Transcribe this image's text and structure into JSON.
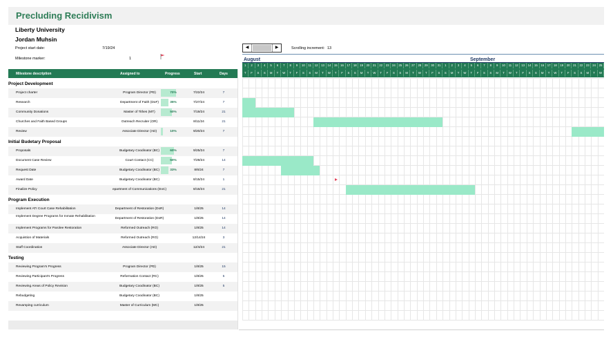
{
  "title": "Precluding Recidivism",
  "organization": "Liberty University",
  "author": "Jordan Muhsin",
  "meta": {
    "start_label": "Project start date:",
    "start_value": "7/19/24",
    "marker_label": "Milestone marker:",
    "marker_value": "1"
  },
  "scroll": {
    "left_label": "◀",
    "right_label": "▶",
    "increment_label": "Scrolling increment:",
    "increment_value": "13"
  },
  "months": [
    "August",
    "September"
  ],
  "day_numbers": [
    "1",
    "2",
    "3",
    "4",
    "5",
    "6",
    "7",
    "8",
    "9",
    "10",
    "11",
    "12",
    "13",
    "14",
    "15",
    "16",
    "17",
    "18",
    "19",
    "20",
    "21",
    "22",
    "23",
    "24",
    "25",
    "26",
    "27",
    "28",
    "29",
    "30",
    "31",
    "1",
    "2",
    "3",
    "4",
    "5",
    "6",
    "7",
    "8",
    "9",
    "10",
    "11",
    "12",
    "13",
    "14",
    "15",
    "16",
    "17",
    "18",
    "19",
    "20",
    "21",
    "22",
    "23",
    "24",
    "25"
  ],
  "day_letters": [
    "T",
    "F",
    "S",
    "S",
    "M",
    "T",
    "W",
    "T",
    "F",
    "S",
    "S",
    "M",
    "T",
    "W",
    "T",
    "F",
    "S",
    "S",
    "M",
    "T",
    "W",
    "T",
    "F",
    "S",
    "S",
    "M",
    "T",
    "W",
    "T",
    "F",
    "S",
    "S",
    "M",
    "T",
    "W",
    "T",
    "F",
    "S",
    "S",
    "M",
    "T",
    "W",
    "T",
    "F",
    "S",
    "S",
    "M",
    "T",
    "W",
    "T",
    "F",
    "S",
    "S",
    "M",
    "T",
    "W"
  ],
  "columns": {
    "desc": "Milestone description",
    "assigned": "Assigned to",
    "progress": "Progress",
    "start": "Start",
    "days": "Days"
  },
  "sections": [
    {
      "name": "Project Development",
      "rows": [
        {
          "desc": "Project charter",
          "assigned": "Program Director (PD)",
          "progress": "70%",
          "pct": 0.7,
          "start": "7/22/24",
          "days": "7",
          "bar": null
        },
        {
          "desc": "Research",
          "assigned": "Department of Faith (DoF)",
          "progress": "35%",
          "pct": 0.35,
          "start": "7/27/24",
          "days": "7",
          "bar": [
            0,
            1
          ]
        },
        {
          "desc": "Community Donations",
          "assigned": "Master of Tithes (MT)",
          "progress": "50%",
          "pct": 0.5,
          "start": "7/19/24",
          "days": "21",
          "bar": [
            0,
            7
          ]
        },
        {
          "desc": "Churches and Faith Based Groups",
          "assigned": "Outreach Recruiter (OR)",
          "progress": "",
          "pct": 0,
          "start": "8/11/24",
          "days": "21",
          "bar": [
            11,
            30
          ]
        },
        {
          "desc": "Review",
          "assigned": "Associate Director (AD)",
          "progress": "10%",
          "pct": 0.1,
          "start": "9/20/24",
          "days": "7",
          "bar": [
            51,
            56
          ]
        }
      ]
    },
    {
      "name": "Initial Budetary Proposal",
      "rows": [
        {
          "desc": "Proposals",
          "assigned": "Budgetary Coodinator (BC)",
          "progress": "60%",
          "pct": 0.6,
          "start": "9/25/24",
          "days": "7",
          "bar": null
        },
        {
          "desc": "Document Case Review",
          "assigned": "Court Contact (CC)",
          "progress": "50%",
          "pct": 0.5,
          "start": "7/29/24",
          "days": "14",
          "bar": [
            0,
            10
          ]
        },
        {
          "desc": "Request Date",
          "assigned": "Budgetary Coodinator (BC)",
          "progress": "33%",
          "pct": 0.33,
          "start": "8/6/24",
          "days": "7",
          "bar": [
            6,
            11
          ]
        },
        {
          "desc": "Award Date",
          "assigned": "Budgetary Coodinator (BC)",
          "progress": "",
          "pct": 0,
          "start": "8/15/24",
          "days": "1",
          "bar": null,
          "marker": 14
        },
        {
          "desc": "Finalize Policy",
          "assigned": "epartment of Communications (DoC)",
          "progress": "",
          "pct": 0,
          "start": "8/16/24",
          "days": "21",
          "bar": [
            16,
            35
          ]
        }
      ]
    },
    {
      "name": "Program Execution",
      "rows": [
        {
          "desc": "Implement ATI Court Case Rehabilitation",
          "assigned": "Department of Restoration (DoR)",
          "progress": "",
          "pct": 0,
          "start": "1/8/25",
          "days": "14",
          "bar": null
        },
        {
          "desc": "Implement Degree Programs for Inmate Rehabilitation",
          "assigned": "Department of Restoration (DoR)",
          "progress": "",
          "pct": 0,
          "start": "1/8/25",
          "days": "14",
          "bar": null
        },
        {
          "desc": "Implement Programs for Parolee Restoration",
          "assigned": "Reformed Outreach (RO)",
          "progress": "",
          "pct": 0,
          "start": "1/8/25",
          "days": "14",
          "bar": null
        },
        {
          "desc": "Acquistion of Materials",
          "assigned": "Reformed Outreach (RO)",
          "progress": "",
          "pct": 0,
          "start": "12/14/24",
          "days": "3",
          "bar": null
        },
        {
          "desc": "Staff Coordination",
          "assigned": "Associate Director (AD)",
          "progress": "",
          "pct": 0,
          "start": "12/4/24",
          "days": "21",
          "bar": null
        }
      ]
    },
    {
      "name": "Testing",
      "rows": [
        {
          "desc": "Reviewing Program's Progress",
          "assigned": "Program Director (PD)",
          "progress": "",
          "pct": 0,
          "start": "1/8/25",
          "days": "15",
          "bar": null
        },
        {
          "desc": "Reviewing Participant's Progress",
          "assigned": "Reformation Contact (RC)",
          "progress": "",
          "pct": 0,
          "start": "1/8/25",
          "days": "5",
          "bar": null
        },
        {
          "desc": "Reviewing Areas of Policy Revision",
          "assigned": "Budgetary Coodinator (BC)",
          "progress": "",
          "pct": 0,
          "start": "1/8/25",
          "days": "5",
          "bar": null
        },
        {
          "desc": "Rebudgeting",
          "assigned": "Budgetary Coodinator (BC)",
          "progress": "",
          "pct": 0,
          "start": "1/8/25",
          "days": "",
          "bar": null
        },
        {
          "desc": "Revamping curriculum",
          "assigned": "Master of Curriculum (MC)",
          "progress": "",
          "pct": 0,
          "start": "1/8/25",
          "days": "",
          "bar": null
        }
      ]
    }
  ],
  "colors": {
    "brand": "#237a54",
    "bar": "#9ae9c8",
    "progress_fill": "#b6ead0",
    "marker": "#e2465c"
  }
}
